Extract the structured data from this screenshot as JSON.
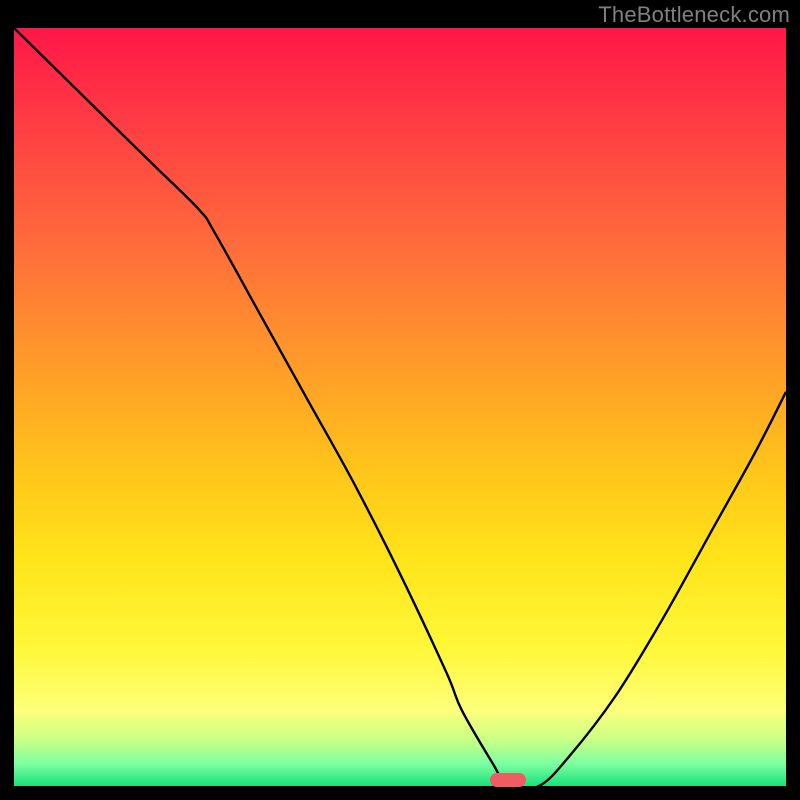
{
  "attribution": "TheBottleneck.com",
  "colors": {
    "attribution_text": "#808080",
    "background": "#000000",
    "curve": "#000000",
    "marker": "#ef5d63",
    "gradient": [
      "#ff1748",
      "#ff3b44",
      "#ff6a3c",
      "#ff9a2a",
      "#ffc41a",
      "#ffe41a",
      "#fff83a",
      "#fdff7a",
      "#c8ff86",
      "#7fffa2",
      "#18e27a"
    ]
  },
  "plot": {
    "x_range": [
      0,
      100
    ],
    "y_range": [
      0,
      100
    ],
    "marker_x_fraction": 0.64,
    "marker_y_fraction": 1.0
  },
  "chart_data": {
    "type": "line",
    "title": "",
    "xlabel": "",
    "ylabel": "",
    "xlim": [
      0,
      100
    ],
    "ylim": [
      0,
      100
    ],
    "series": [
      {
        "name": "bottleneck-curve",
        "x": [
          0,
          6,
          12,
          18,
          24,
          26,
          32,
          38,
          44,
          50,
          56,
          58,
          62,
          64,
          68,
          72,
          78,
          84,
          90,
          96,
          100
        ],
        "y": [
          100,
          94,
          88,
          82,
          76,
          73,
          62,
          51,
          40,
          28,
          15,
          10,
          3,
          0,
          0,
          4,
          12,
          22,
          33,
          44,
          52
        ]
      }
    ],
    "annotations": [
      {
        "type": "marker",
        "x": 64,
        "y": 0,
        "label": "optimal-point"
      }
    ]
  }
}
